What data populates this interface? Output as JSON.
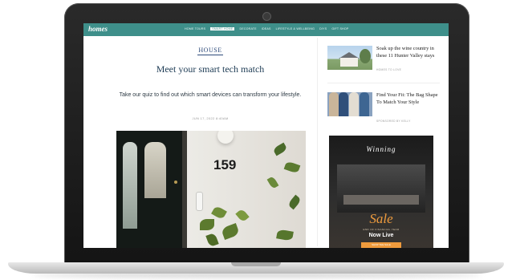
{
  "site": {
    "logo": "homes",
    "nav": [
      {
        "label": "HOME TOURS",
        "active": false
      },
      {
        "label": "SMART HOME",
        "active": true
      },
      {
        "label": "DECORATE",
        "active": false
      },
      {
        "label": "IDEAS",
        "active": false
      },
      {
        "label": "LIFESTYLE & WELLBEING",
        "active": false
      },
      {
        "label": "DIYS",
        "active": false
      },
      {
        "label": "GIFT SHOP",
        "active": false
      }
    ]
  },
  "article": {
    "publication": "HOUSE",
    "headline": "Meet your smart tech match",
    "dek": "Take our quiz to find out which smart devices can transform your lifestyle.",
    "meta": "JUN 17, 2022 8:40AM",
    "hero_number": "159"
  },
  "sidebar": {
    "cards": [
      {
        "title": "Soak up the wine country in these 11 Hunter Valley stays",
        "source": "HOMES TO LOVE"
      },
      {
        "title": "Find Your Fit: The Bag Shape To Match Your Style",
        "source": "SPONSORED BY KELLY"
      }
    ],
    "ad": {
      "brand": "Winning",
      "headline": "Sale",
      "subline": "END OF FINANCIAL YEAR",
      "status": "Now Live",
      "cta": "SHOP THE SALE"
    }
  },
  "colors": {
    "nav_bg": "#3e8f8a",
    "headline": "#1e3c55",
    "ad_accent": "#ef9b3d"
  }
}
